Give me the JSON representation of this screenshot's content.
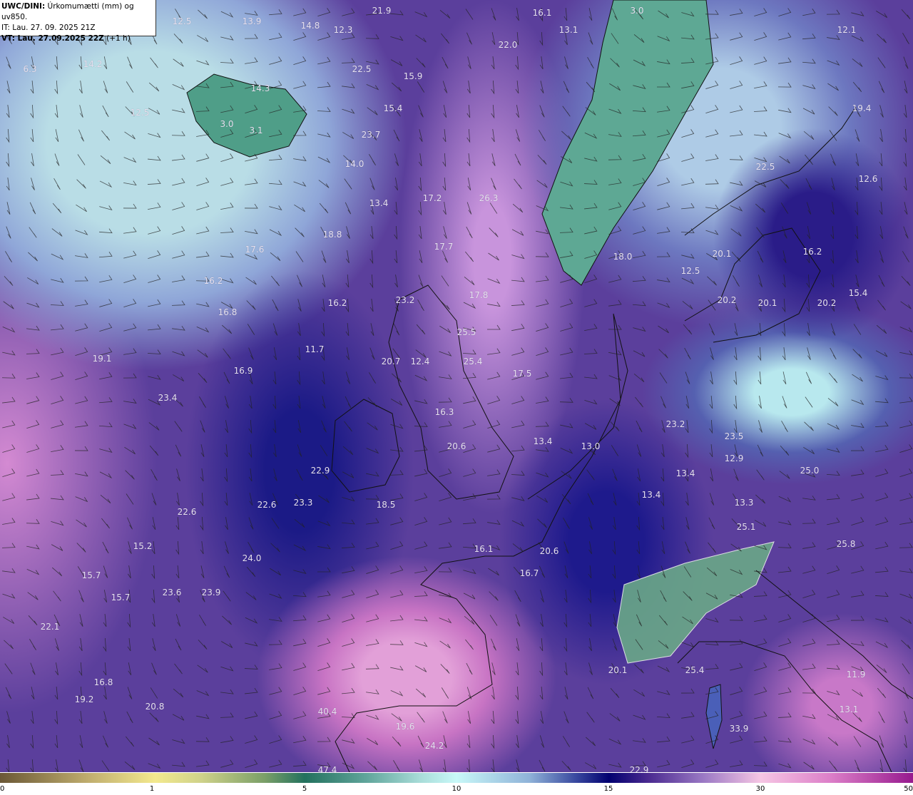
{
  "header": {
    "model": "UWC/DINI:",
    "parameter": "Úrkomumætti (mm) og uv850.",
    "initial_time": "IT: Lau. 27. 09. 2025 21Z",
    "valid_time": "VT: Lau. 27.09.2025 22Z",
    "lead": "(+1 h)"
  },
  "colorbar": {
    "ticks": [
      "0",
      "1",
      "5",
      "10",
      "15",
      "30",
      "50"
    ],
    "colors": [
      "#6b5836",
      "#f3e98e",
      "#23715e",
      "#c8f8f8",
      "#020070",
      "#f6c6e4",
      "#961a8e"
    ]
  },
  "map_values": [
    "21.9",
    "16.1",
    "3.0",
    "12.5",
    "13.9",
    "14.8",
    "12.3",
    "13.1",
    "12.1",
    "22.0",
    "6.3",
    "14.2",
    "22.5",
    "15.9",
    "14.3",
    "15.4",
    "19.4",
    "12.5",
    "3.0",
    "3.1",
    "23.7",
    "14.0",
    "22.5",
    "12.6",
    "17.2",
    "26.3",
    "13.4",
    "18.8",
    "17.7",
    "17.6",
    "20.1",
    "16.2",
    "18.0",
    "12.5",
    "16.2",
    "17.8",
    "15.4",
    "23.2",
    "16.2",
    "20.2",
    "20.1",
    "20.2",
    "16.8",
    "25.5",
    "11.7",
    "19.1",
    "20.7",
    "12.4",
    "25.4",
    "16.9",
    "17.5",
    "23.4",
    "16.3",
    "23.2",
    "23.5",
    "13.4",
    "13.0",
    "20.6",
    "12.9",
    "25.0",
    "22.9",
    "13.4",
    "13.4",
    "22.6",
    "23.3",
    "18.5",
    "13.3",
    "22.6",
    "25.1",
    "15.2",
    "16.1",
    "20.6",
    "25.8",
    "24.0",
    "15.7",
    "16.7",
    "15.7",
    "23.6",
    "23.9",
    "22.1",
    "20.1",
    "25.4",
    "11.9",
    "16.8",
    "19.2",
    "20.8",
    "40.4",
    "13.1",
    "19.6",
    "33.9",
    "24.2",
    "47.4",
    "22.9"
  ]
}
